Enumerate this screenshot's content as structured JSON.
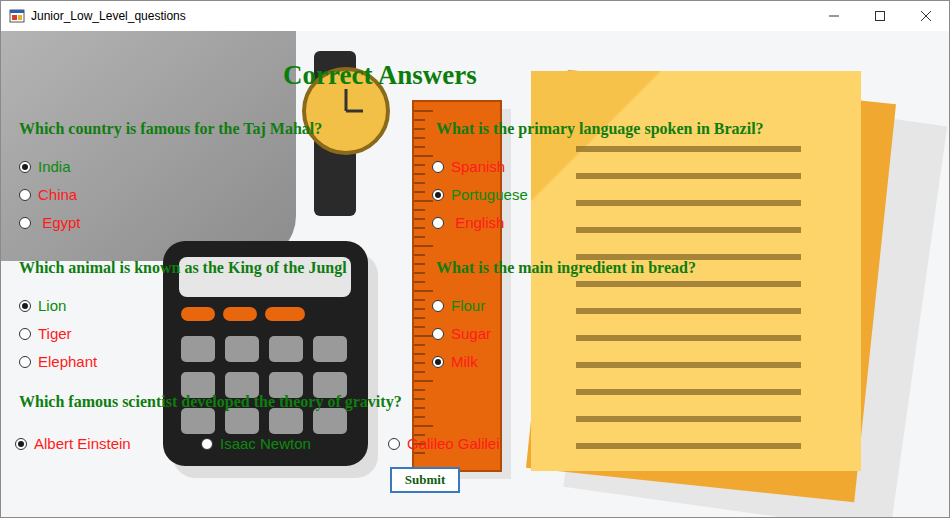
{
  "window": {
    "title": "Junior_Low_Level_questions"
  },
  "heading": "Correct Answers",
  "left_column": [
    {
      "question": "Which country is famous for the Taj Mahal?",
      "options": [
        {
          "label": "India",
          "selected": true,
          "correct": true
        },
        {
          "label": "China",
          "selected": false,
          "correct": false
        },
        {
          "label": " Egypt",
          "selected": false,
          "correct": false
        }
      ]
    },
    {
      "question": "Which animal is known as the King of the Jungl",
      "options": [
        {
          "label": "Lion",
          "selected": true,
          "correct": true
        },
        {
          "label": "Tiger",
          "selected": false,
          "correct": false
        },
        {
          "label": "Elephant",
          "selected": false,
          "correct": false
        }
      ]
    }
  ],
  "right_column": [
    {
      "question": "What is the primary language spoken in Brazil?",
      "options": [
        {
          "label": "Spanish",
          "selected": false,
          "correct": false
        },
        {
          "label": "Portuguese",
          "selected": true,
          "correct": true
        },
        {
          "label": " English",
          "selected": false,
          "correct": false
        }
      ]
    },
    {
      "question": "What is the main ingredient in bread?",
      "options": [
        {
          "label": "Flour",
          "selected": false,
          "correct": true
        },
        {
          "label": "Sugar",
          "selected": false,
          "correct": false
        },
        {
          "label": "Milk",
          "selected": true,
          "correct": false
        }
      ]
    }
  ],
  "bottom_question": {
    "question": "Which famous scientist developed the theory of gravity?",
    "options": [
      {
        "label": "Albert Einstein",
        "selected": true,
        "correct": false
      },
      {
        "label": "Isaac Newton",
        "selected": false,
        "correct": true
      },
      {
        "label": "Galileo Galilei",
        "selected": false,
        "correct": false
      }
    ]
  },
  "buttons": [
    "Submit"
  ]
}
